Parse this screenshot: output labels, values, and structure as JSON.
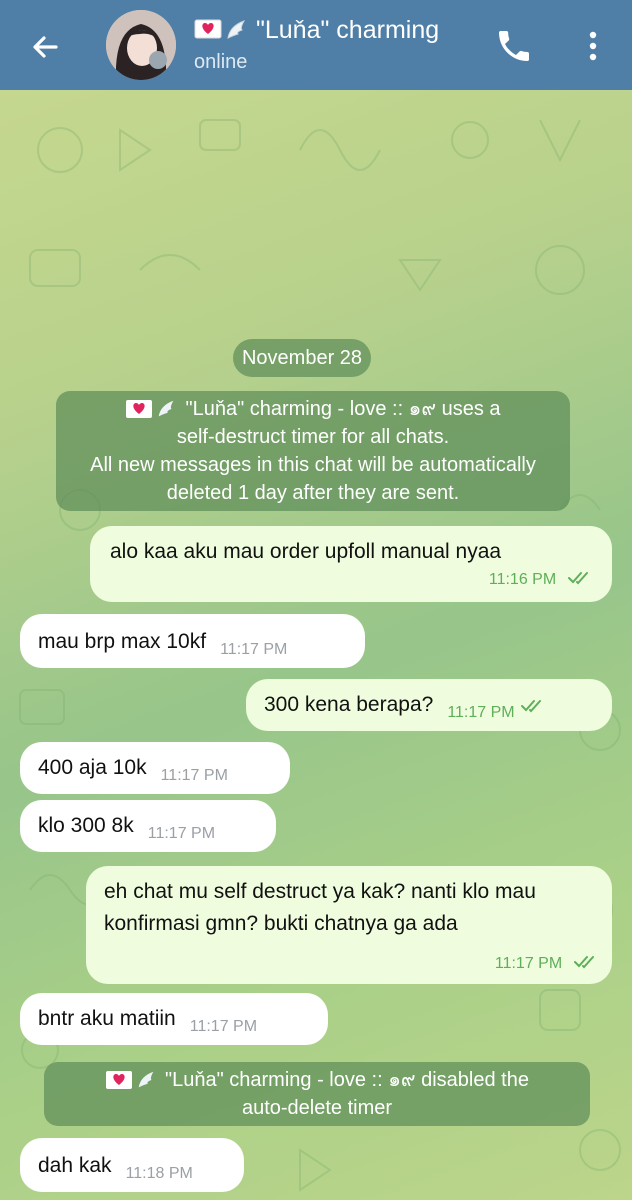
{
  "header": {
    "title": "\"Luňa\" charming",
    "status": "online"
  },
  "date_separator": "November 28",
  "service_messages": [
    {
      "lines": [
        "\"Luňa\" charming - love :: ๑๙ uses a",
        "self-destruct timer for all chats.",
        "All new messages in this chat will be automatically",
        "deleted 1 day after they are sent."
      ]
    },
    {
      "lines": [
        "\"Luňa\" charming - love :: ๑๙ disabled the",
        "auto-delete timer"
      ]
    }
  ],
  "messages": [
    {
      "direction": "out",
      "text": "alo kaa aku mau order upfoll manual nyaa",
      "time": "11:16 PM",
      "read": true
    },
    {
      "direction": "in",
      "text": "mau brp max 10kf",
      "time": "11:17 PM"
    },
    {
      "direction": "out",
      "text": "300 kena berapa?",
      "time": "11:17 PM",
      "read": true
    },
    {
      "direction": "in",
      "text": "400 aja 10k",
      "time": "11:17 PM"
    },
    {
      "direction": "in",
      "text": "klo 300 8k",
      "time": "11:17 PM"
    },
    {
      "direction": "out",
      "text": "eh chat mu self destruct ya kak? nanti klo mau konfirmasi gmn? bukti chatnya ga ada",
      "time": "11:17 PM",
      "read": true
    },
    {
      "direction": "in",
      "text": "bntr aku matiin",
      "time": "11:17 PM"
    },
    {
      "direction": "in",
      "text": "dah kak",
      "time": "11:18 PM"
    }
  ],
  "colors": {
    "header_bg": "#4f7fa6",
    "outgoing_bubble": "#effdde",
    "incoming_bubble": "#ffffff",
    "service_pill": "#5e8e59",
    "read_tick": "#5fae5a"
  },
  "icons": [
    "arrow-left-icon",
    "phone-icon",
    "more-vert-icon",
    "heart-envelope-icon",
    "wing-icon",
    "teapot-icon",
    "double-check-icon"
  ]
}
